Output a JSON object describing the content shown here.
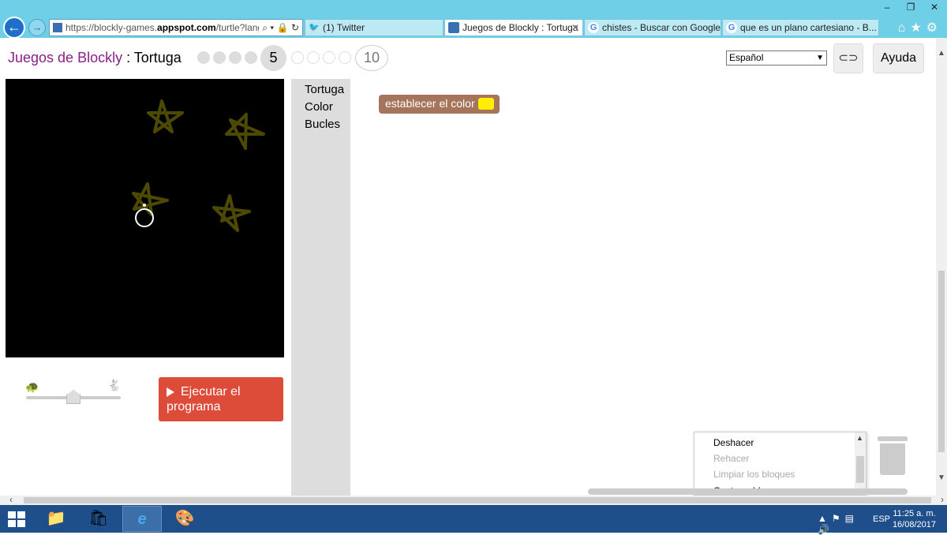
{
  "browser": {
    "url_host": "https://blockly-games.",
    "url_domain": "appspot.com",
    "url_rest": "/turtle?lang=es",
    "tabs": [
      {
        "label": "(1) Twitter",
        "icon": "twitter-icon",
        "active": false
      },
      {
        "label": "Juegos de Blockly : Tortuga",
        "icon": "blockly-icon",
        "active": true
      },
      {
        "label": "chistes - Buscar con Google",
        "icon": "google-icon",
        "active": false
      },
      {
        "label": "que es un plano cartesiano - B...",
        "icon": "google-icon",
        "active": false
      }
    ],
    "window_controls": [
      "minimize",
      "maximize",
      "close"
    ]
  },
  "header": {
    "title_brand": "Juegos de Blockly",
    "title_separator": " : ",
    "title_game": "Tortuga",
    "current_level": "5",
    "max_level": "10",
    "language": "Español",
    "help_label": "Ayuda"
  },
  "canvas": {
    "background": "#000000",
    "star_color": "#4d4a00",
    "turtle_color": "#ffffff"
  },
  "controls": {
    "run_label": "Ejecutar el programa",
    "speed_level": 0.5
  },
  "toolbox": {
    "categories": [
      "Tortuga",
      "Color",
      "Bucles"
    ]
  },
  "workspace": {
    "block_text": "establecer el color a",
    "block_color": "#a5745b",
    "block_swatch": "#ffee00"
  },
  "context_menu": {
    "items": [
      {
        "label": "Deshacer",
        "enabled": true
      },
      {
        "label": "Rehacer",
        "enabled": false
      },
      {
        "label": "Limpiar los bloques",
        "enabled": false
      },
      {
        "label": "Contraer bloques",
        "enabled": true
      }
    ]
  },
  "taskbar": {
    "apps": [
      "file-explorer-icon",
      "store-icon",
      "internet-explorer-icon",
      "paint-icon"
    ],
    "language": "ESP",
    "time": "11:25 a. m.",
    "date": "16/08/2017"
  }
}
